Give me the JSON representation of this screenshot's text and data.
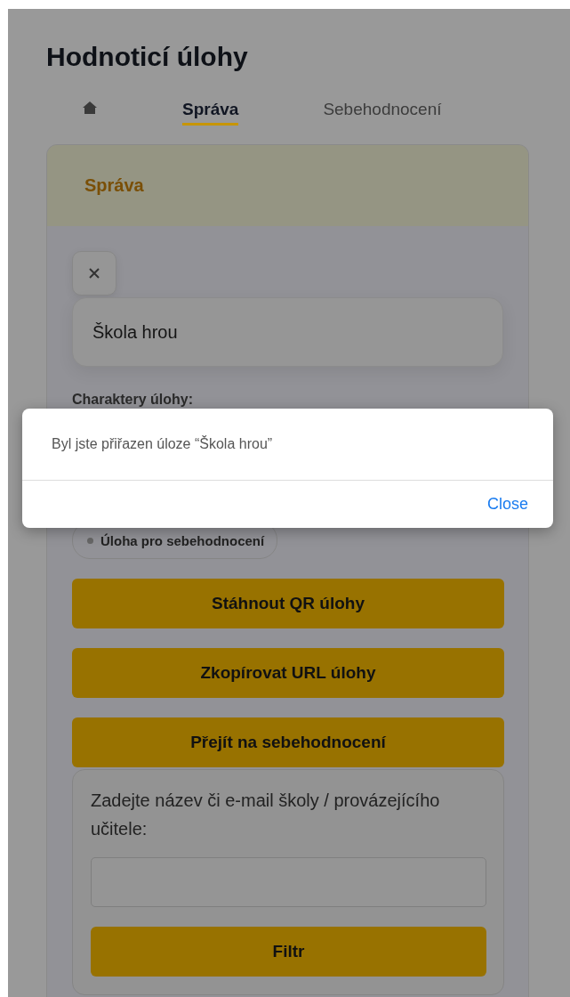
{
  "title": "Hodnoticí úlohy",
  "tabs": [
    {
      "kind": "home",
      "selected": false
    },
    {
      "kind": "text",
      "label": "Správa",
      "selected": true
    },
    {
      "kind": "text",
      "label": "Sebehodnocení",
      "selected": false
    }
  ],
  "card": {
    "header": "Správa",
    "task_name": "Škola hrou",
    "characters_label": "Charaktery úlohy:",
    "chips": [
      "Úloha pro sebehodnocení"
    ],
    "buttons": [
      "Stáhnout QR úlohy",
      "Zkopírovat URL úlohy",
      "Přejít na sebehodnocení"
    ],
    "filter": {
      "label": "Zadejte název či e-mail školy / provázejícího učitele:",
      "button": "Filtr"
    }
  },
  "dialog": {
    "message": "Byl jste přiřazen úloze “Škola hrou”",
    "button": "Close"
  }
}
